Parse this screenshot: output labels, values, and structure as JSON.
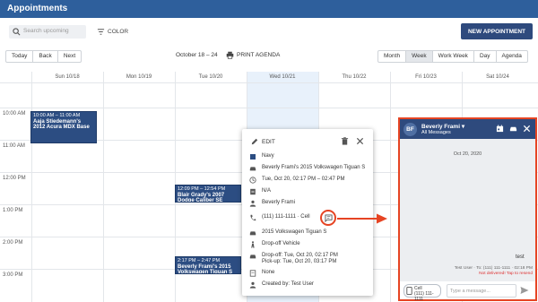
{
  "app": {
    "title": "Appointments"
  },
  "toolbar": {
    "search_placeholder": "Search upcoming",
    "color_label": "COLOR",
    "new_appointment_label": "NEW APPOINTMENT"
  },
  "nav": {
    "today": "Today",
    "back": "Back",
    "next": "Next",
    "date_range": "October 18 – 24",
    "print_agenda": "PRINT AGENDA",
    "views": [
      "Month",
      "Week",
      "Work Week",
      "Day",
      "Agenda"
    ],
    "active_view": "Week"
  },
  "calendar": {
    "days": [
      "Sun 10/18",
      "Mon 10/19",
      "Tue 10/20",
      "Wed 10/21",
      "Thu 10/22",
      "Fri 10/23",
      "Sat 10/24"
    ],
    "today_index": 3,
    "times": [
      "10:00 AM",
      "11:00 AM",
      "12:00 PM",
      "1:00 PM",
      "2:00 PM",
      "3:00 PM"
    ],
    "events": [
      {
        "time": "10:00 AM – 11:00 AM",
        "title": "Aaja Stiedemann's 2012 Acura MDX Base"
      },
      {
        "time": "12:09 PM – 12:54 PM",
        "title": "Blair Grady's 2007 Dodge Caliber SE"
      },
      {
        "time": "2:17 PM – 2:47 PM",
        "title": "Beverly Frami's 2015 Volkswagen Tiguan S"
      }
    ]
  },
  "popup": {
    "edit_label": "EDIT",
    "color": "Navy",
    "vehicle": "Beverly Frami's 2015 Volkswagen Tiguan S",
    "time": "Tue, Oct 20, 02:17 PM – 02:47 PM",
    "na": "N/A",
    "customer": "Beverly Frami",
    "phone": "(111) 111-1111 · Cell",
    "model": "2015 Volkswagen Tiguan S",
    "service": "Drop-off Vehicle",
    "dropoff": "Drop-off: Tue, Oct 20, 02:17 PM",
    "pickup": "Pick-up: Tue, Oct 20, 03:17 PM",
    "none": "None",
    "created_by": "Created by: Test User"
  },
  "messages": {
    "initials": "BF",
    "name": "Beverly Frami",
    "subtitle": "All Messages",
    "date": "Oct 20, 2020",
    "message_text": "test",
    "meta": "Test User · To: (111) 111-1111 · 02:18 PM",
    "error": "Not delivered! Tap to resend",
    "cell_label": "Cell",
    "cell_number": "(111) 111-1111",
    "input_placeholder": "Type a message..."
  },
  "colors": {
    "topbar": "#2e5f9c",
    "event": "#2c4d82",
    "highlight": "#e64423",
    "today": "#e8f1fb"
  }
}
